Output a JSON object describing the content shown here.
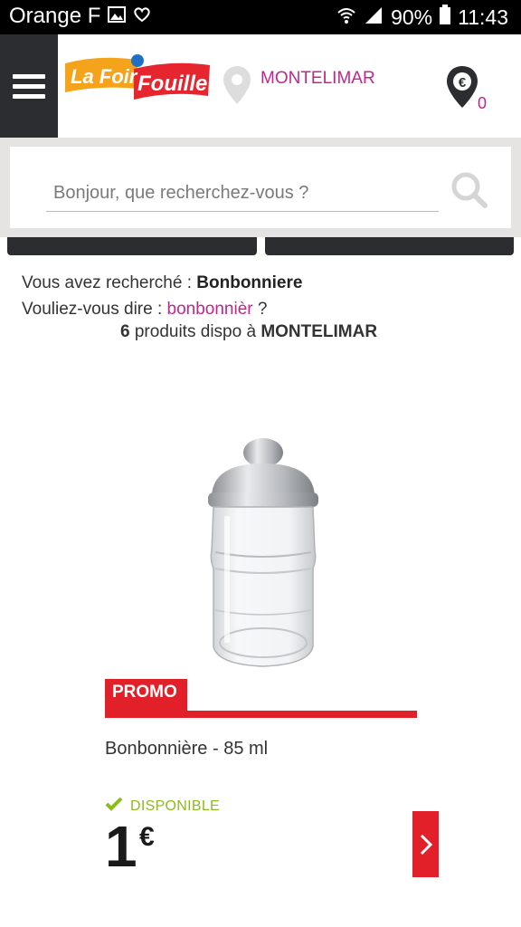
{
  "statusbar": {
    "carrier": "Orange F",
    "battery": "90%",
    "time": "11:43"
  },
  "header": {
    "logo_text_1": "La Foir",
    "logo_text_2": "Fouille",
    "location": "MONTELIMAR",
    "cart_count": "0"
  },
  "search": {
    "placeholder": "Bonjour, que recherchez-vous ?"
  },
  "results": {
    "searched_label": "Vous avez recherché :",
    "searched_term": "Bonbonniere",
    "suggest_label": "Vouliez-vous dire :",
    "suggest_term": "bonbonnièr",
    "suggest_suffix": "?",
    "count": "6",
    "count_label": "produits",
    "dispo_label": "dispo à",
    "dispo_location": "MONTELIMAR"
  },
  "product": {
    "promo_label": "PROMO",
    "name": "Bonbonnière - 85 ml",
    "availability": "DISPONIBLE",
    "price": "1",
    "currency": "€"
  },
  "colors": {
    "accent_pink": "#c3258f",
    "promo_red": "#e2202a",
    "available_green": "#8dbb1b",
    "dark": "#2b2d30"
  },
  "icons": {
    "menu": "hamburger-icon",
    "location": "location-pin-icon",
    "store": "store-euro-pin-icon",
    "search": "search-icon",
    "check": "check-icon",
    "next": "chevron-right-icon"
  }
}
